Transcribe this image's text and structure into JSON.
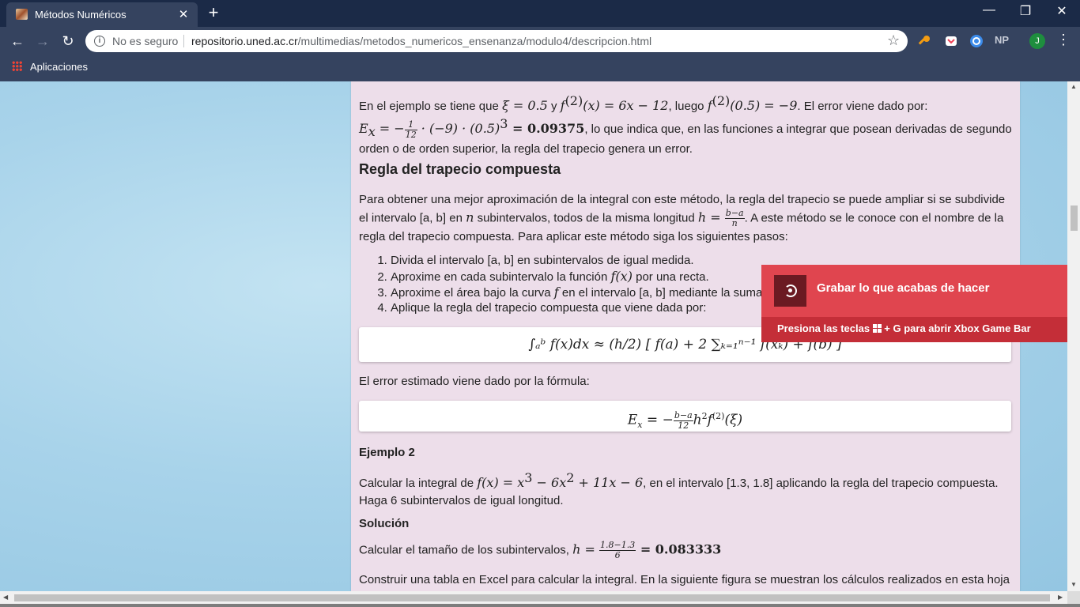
{
  "browser": {
    "tab_title": "Métodos Numéricos",
    "tab_close": "✕",
    "new_tab": "+",
    "security_label": "No es seguro",
    "url_host": "repositorio.uned.ac.cr",
    "url_path": "/multimedias/metodos_numericos_ensenanza/modulo4/descripcion.html",
    "window_controls": {
      "minimize": "—",
      "maximize": "❐",
      "close": "✕"
    },
    "extensions": [
      "key-icon",
      "pocket-icon",
      "vpn-icon",
      "np-icon"
    ],
    "ext_np_label": "NP",
    "avatar_initial": "J",
    "bookmarks": {
      "apps_label": "Aplicaciones"
    }
  },
  "article": {
    "p1_a": "En el ejemplo se tiene que ",
    "p1_xi": "ξ = 0.5",
    "p1_b": " y ",
    "p1_f2": "f",
    "p1_f2_sup": "(2)",
    "p1_f2_rest": "(x) = 6x − 12",
    "p1_c": ", luego ",
    "p1_f2b": "f",
    "p1_f2b_sup": "(2)",
    "p1_f2b_rest": "(0.5) = −9",
    "p1_d": ". El error viene dado por:",
    "p1_err_lhs": "E",
    "p1_err_sub": "x",
    "p1_err_eq": " = −",
    "p1_err_num": "1",
    "p1_err_den": "12",
    "p1_err_rest": " · (−9) · (0.5)",
    "p1_err_exp": "3",
    "p1_err_val": " = 0.09375",
    "p1_e": ", lo que indica que, en las funciones a integrar que posean derivadas de segundo orden o de orden superior, la regla del trapecio genera un error.",
    "h_compuesta": "Regla del trapecio compuesta",
    "p2_a": "Para obtener una mejor aproximación de la integral con este método, la regla del trapecio se puede ampliar si se subdivide el intervalo [a, b] en ",
    "p2_n": "n",
    "p2_b": " subintervalos, todos de la misma longitud ",
    "p2_h": "h = ",
    "p2_h_num": "b−a",
    "p2_h_den": "n",
    "p2_c": ". A este método se le conoce con el nombre de la regla del trapecio compuesta. Para aplicar este método  siga los siguientes pasos:",
    "step1": "Divida el intervalo [a, b] en subintervalos de igual medida.",
    "step2_a": "Aproxime en cada subintervalo la función ",
    "step2_fx": "f(x)",
    "step2_b": " por una recta.",
    "step3_a": "Aproxime el área bajo la curva ",
    "step3_f": "f",
    "step3_b": " en el intervalo [a, b] mediante la suma",
    "step4": "Aplique la regla del trapecio compuesta que viene dada por:",
    "formula1": "∫ₐᵇ f(x)dx ≈ (h/2) [ f(a) + 2 ∑ₖ₌₁ⁿ⁻¹ f(xₖ) + f(b) ]",
    "p3": "El error estimado viene dado por la fórmula:",
    "formula2_lhs": "E",
    "formula2_sub": "x",
    "formula2_eq": " = −",
    "formula2_num": "b−a",
    "formula2_den": "12",
    "formula2_rest": "h",
    "formula2_h_exp": "2",
    "formula2_f": "f",
    "formula2_f_sup": "(2)",
    "formula2_xi": "(ξ)",
    "h_ejemplo2": "Ejemplo 2",
    "p4_a": "Calcular la integral de ",
    "p4_f": "f(x) = x",
    "p4_f_e1": "3",
    "p4_f_b": " − 6x",
    "p4_f_e2": "2",
    "p4_f_c": " + 11x − 6",
    "p4_b": ", en el intervalo [1.3, 1.8] aplicando la regla del trapecio compuesta. Haga 6 subintervalos de igual longitud.",
    "h_solucion": "Solución",
    "p5_a": "Calcular el tamaño de los subintervalos, ",
    "p5_h": "h = ",
    "p5_num": "1.8−1.3",
    "p5_den": "6",
    "p5_val": " = 0.083333",
    "p6": "Construir una tabla en Excel para calcular la integral. En la siguiente figura se muestran los cálculos realizados en esta hoja"
  },
  "toast": {
    "title": "Grabar lo que acabas de hacer",
    "sub_a": "Presiona las teclas ",
    "sub_b": " + G para abrir Xbox Game Bar"
  },
  "colors": {
    "content_bg": "#eddeea",
    "toast_bg": "#e0454f",
    "toast_footer": "#c42e38",
    "chrome_dark": "#1b2a47",
    "chrome_toolbar": "#35435f"
  }
}
